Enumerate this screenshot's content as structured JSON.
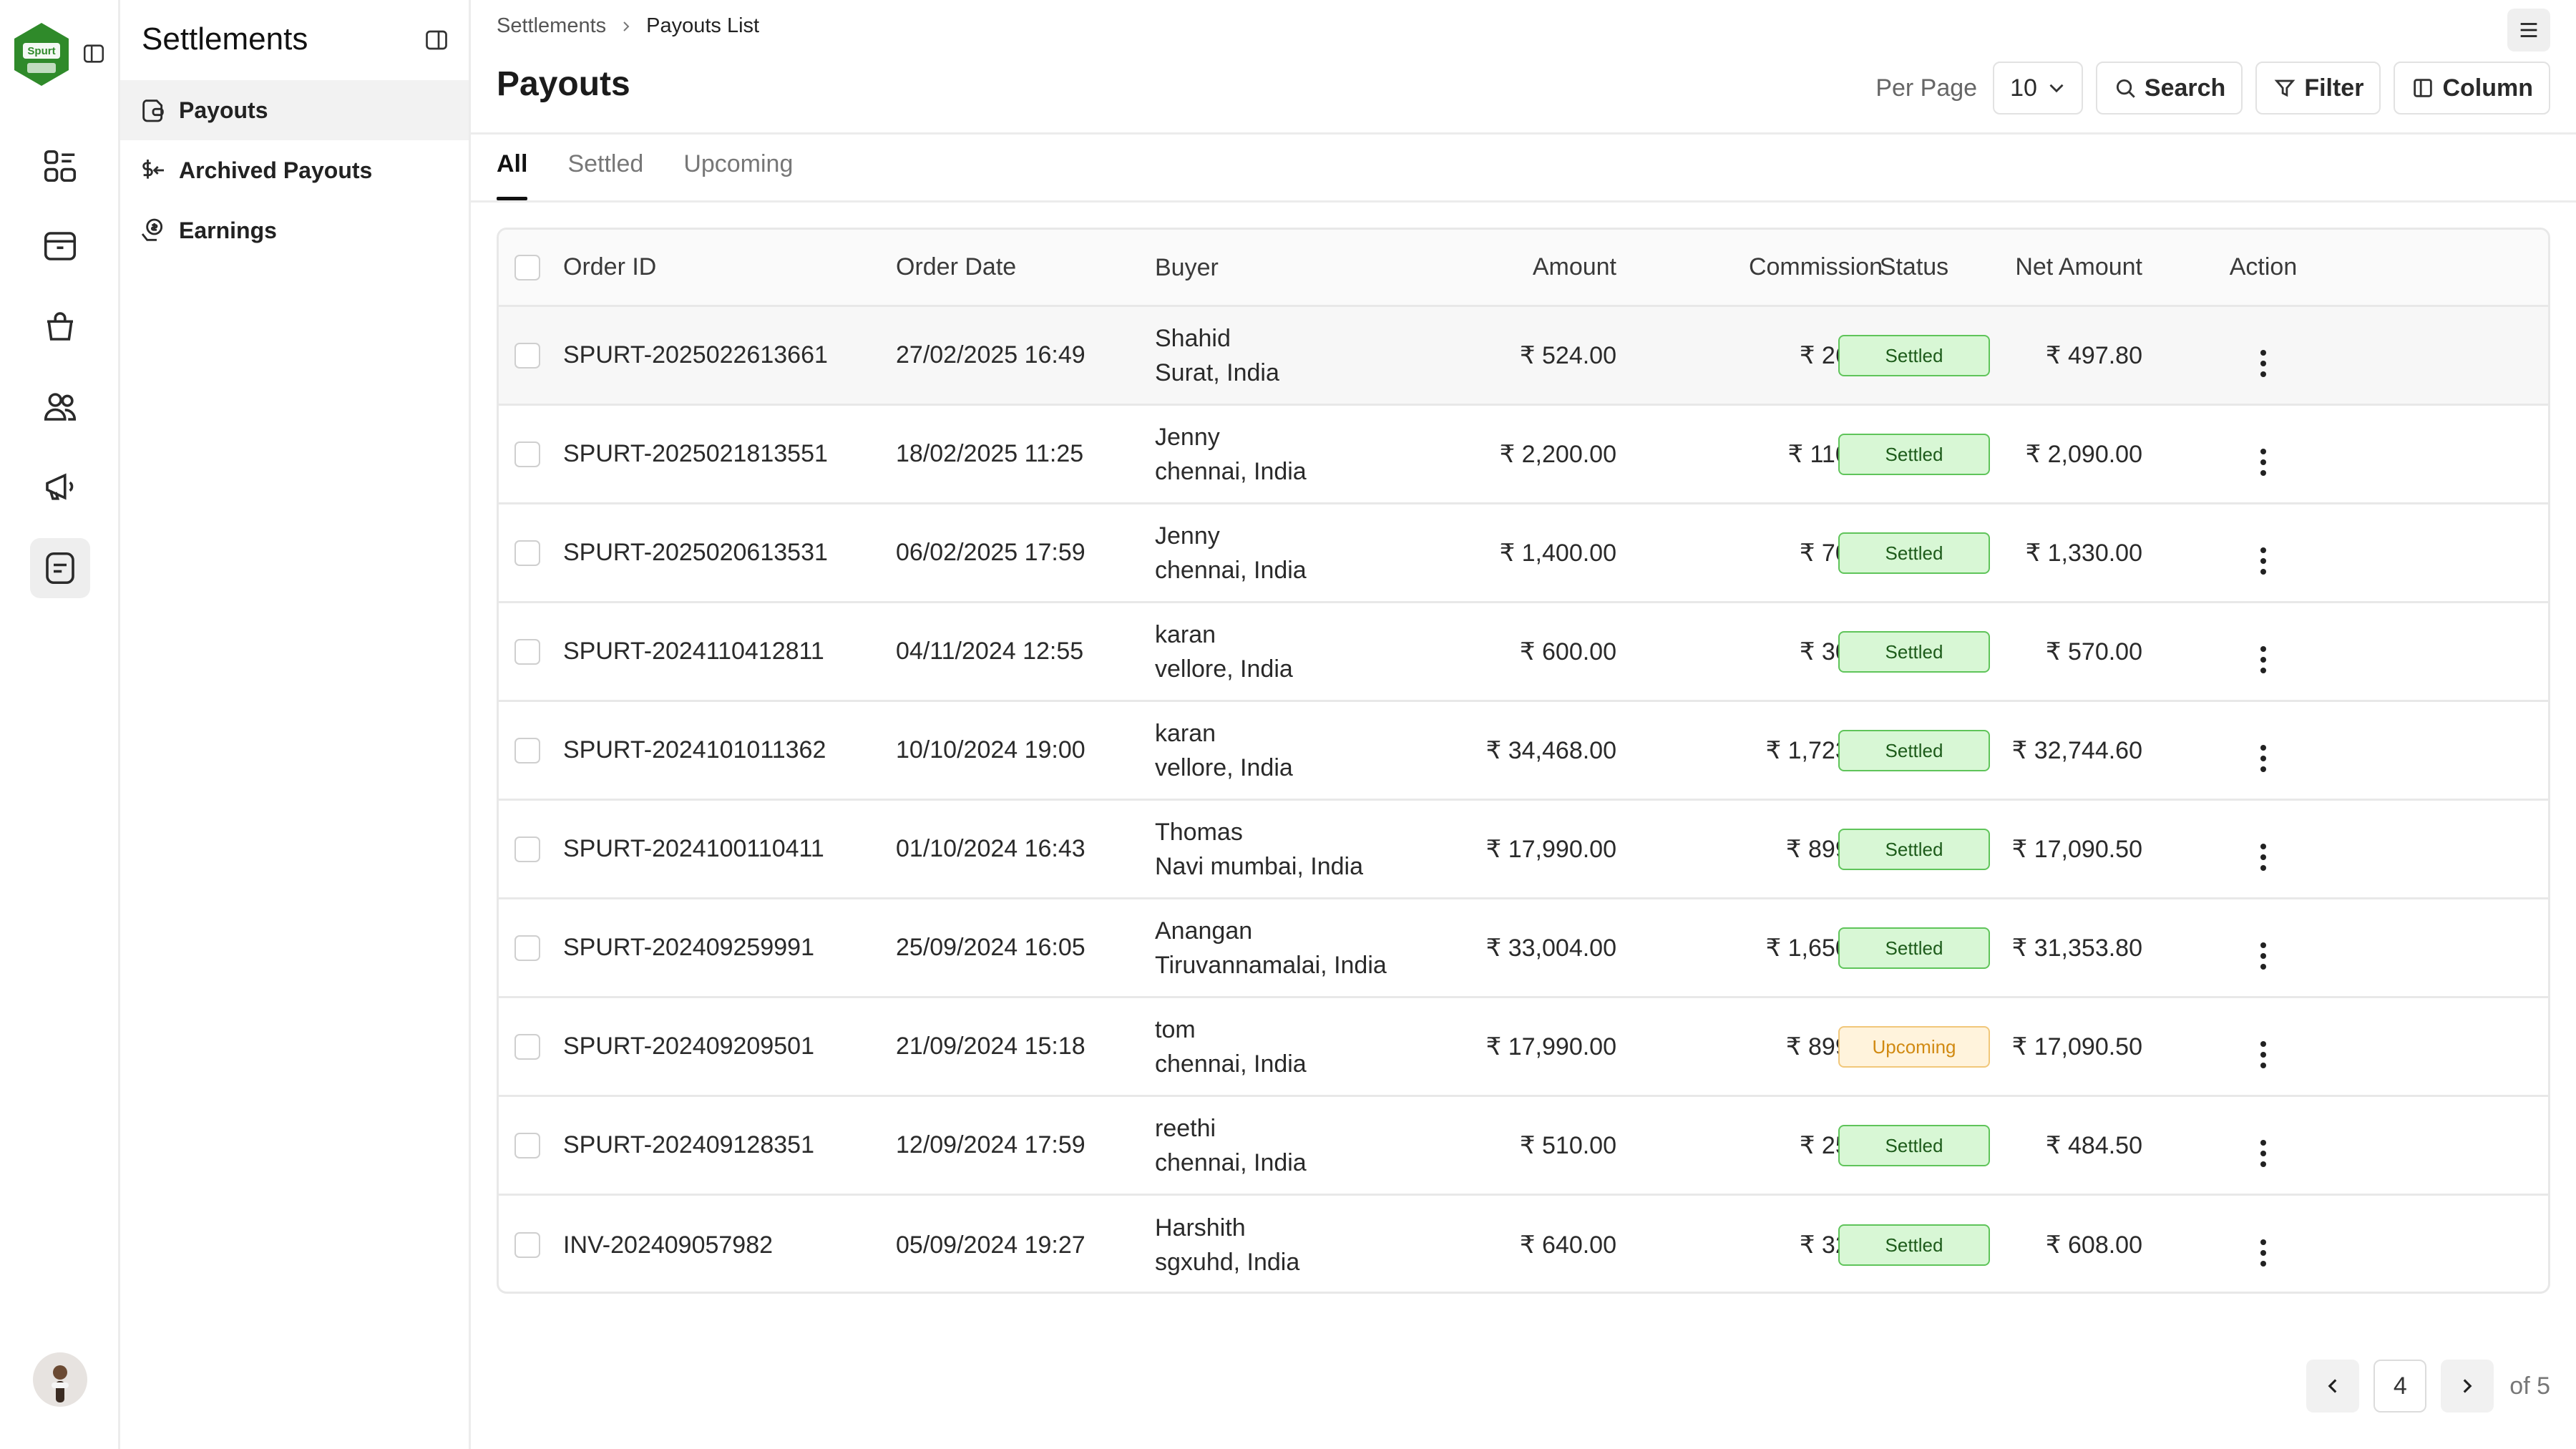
{
  "brand": {
    "logo_text": "Spurt",
    "accent": "#2f8a2a"
  },
  "rail": {
    "items": [
      {
        "icon": "dashboard-icon",
        "active": false
      },
      {
        "icon": "box-icon",
        "active": false
      },
      {
        "icon": "shopping-bag-icon",
        "active": false
      },
      {
        "icon": "users-icon",
        "active": false
      },
      {
        "icon": "megaphone-icon",
        "active": false
      },
      {
        "icon": "settlements-icon",
        "active": true
      }
    ]
  },
  "subnav": {
    "title": "Settlements",
    "items": [
      {
        "label": "Payouts",
        "icon": "wallet-icon",
        "active": true
      },
      {
        "label": "Archived Payouts",
        "icon": "dollar-arrow-icon",
        "active": false
      },
      {
        "label": "Earnings",
        "icon": "coin-hand-icon",
        "active": false
      }
    ]
  },
  "breadcrumb": {
    "root": "Settlements",
    "current": "Payouts List"
  },
  "page": {
    "title": "Payouts"
  },
  "toolbar": {
    "per_page_label": "Per Page",
    "per_page_value": "10",
    "search_label": "Search",
    "filter_label": "Filter",
    "column_label": "Column"
  },
  "tabs": [
    {
      "label": "All",
      "active": true
    },
    {
      "label": "Settled",
      "active": false
    },
    {
      "label": "Upcoming",
      "active": false
    }
  ],
  "table": {
    "headers": {
      "order_id": "Order ID",
      "order_date": "Order Date",
      "buyer": "Buyer",
      "amount": "Amount",
      "commission": "Commission",
      "net_amount": "Net Amount",
      "status": "Status",
      "action": "Action"
    },
    "rows": [
      {
        "order_id": "SPURT-2025022613661",
        "order_date": "27/02/2025 16:49",
        "buyer_name": "Shahid",
        "buyer_location": "Surat, India",
        "amount": "₹ 524.00",
        "commission": "₹ 26.20",
        "net_amount": "₹ 497.80",
        "status": "Settled"
      },
      {
        "order_id": "SPURT-2025021813551",
        "order_date": "18/02/2025 11:25",
        "buyer_name": "Jenny",
        "buyer_location": "chennai, India",
        "amount": "₹ 2,200.00",
        "commission": "₹ 110.00",
        "net_amount": "₹ 2,090.00",
        "status": "Settled"
      },
      {
        "order_id": "SPURT-2025020613531",
        "order_date": "06/02/2025 17:59",
        "buyer_name": "Jenny",
        "buyer_location": "chennai, India",
        "amount": "₹ 1,400.00",
        "commission": "₹ 70.00",
        "net_amount": "₹ 1,330.00",
        "status": "Settled"
      },
      {
        "order_id": "SPURT-2024110412811",
        "order_date": "04/11/2024 12:55",
        "buyer_name": "karan",
        "buyer_location": "vellore, India",
        "amount": "₹ 600.00",
        "commission": "₹ 30.00",
        "net_amount": "₹ 570.00",
        "status": "Settled"
      },
      {
        "order_id": "SPURT-2024101011362",
        "order_date": "10/10/2024 19:00",
        "buyer_name": "karan",
        "buyer_location": "vellore, India",
        "amount": "₹ 34,468.00",
        "commission": "₹ 1,723.40",
        "net_amount": "₹ 32,744.60",
        "status": "Settled"
      },
      {
        "order_id": "SPURT-2024100110411",
        "order_date": "01/10/2024 16:43",
        "buyer_name": "Thomas",
        "buyer_location": "Navi mumbai, India",
        "amount": "₹ 17,990.00",
        "commission": "₹ 899.50",
        "net_amount": "₹ 17,090.50",
        "status": "Settled"
      },
      {
        "order_id": "SPURT-202409259991",
        "order_date": "25/09/2024 16:05",
        "buyer_name": "Anangan",
        "buyer_location": "Tiruvannamalai, India",
        "amount": "₹ 33,004.00",
        "commission": "₹ 1,650.20",
        "net_amount": "₹ 31,353.80",
        "status": "Settled"
      },
      {
        "order_id": "SPURT-202409209501",
        "order_date": "21/09/2024 15:18",
        "buyer_name": "tom",
        "buyer_location": "chennai, India",
        "amount": "₹ 17,990.00",
        "commission": "₹ 899.50",
        "net_amount": "₹ 17,090.50",
        "status": "Upcoming"
      },
      {
        "order_id": "SPURT-202409128351",
        "order_date": "12/09/2024 17:59",
        "buyer_name": "reethi",
        "buyer_location": "chennai, India",
        "amount": "₹ 510.00",
        "commission": "₹ 25.50",
        "net_amount": "₹ 484.50",
        "status": "Settled"
      },
      {
        "order_id": "INV-202409057982",
        "order_date": "05/09/2024 19:27",
        "buyer_name": "Harshith",
        "buyer_location": "sgxuhd, India",
        "amount": "₹ 640.00",
        "commission": "₹ 32.00",
        "net_amount": "₹ 608.00",
        "status": "Settled"
      }
    ]
  },
  "pagination": {
    "current_page": "4",
    "of_label": "of 5"
  },
  "colors": {
    "settled_bg": "#d8f7d5",
    "settled_border": "#5fc45a",
    "upcoming_bg": "#fff3dc",
    "upcoming_border": "#f1c77a",
    "upcoming_text": "#d18a12"
  }
}
